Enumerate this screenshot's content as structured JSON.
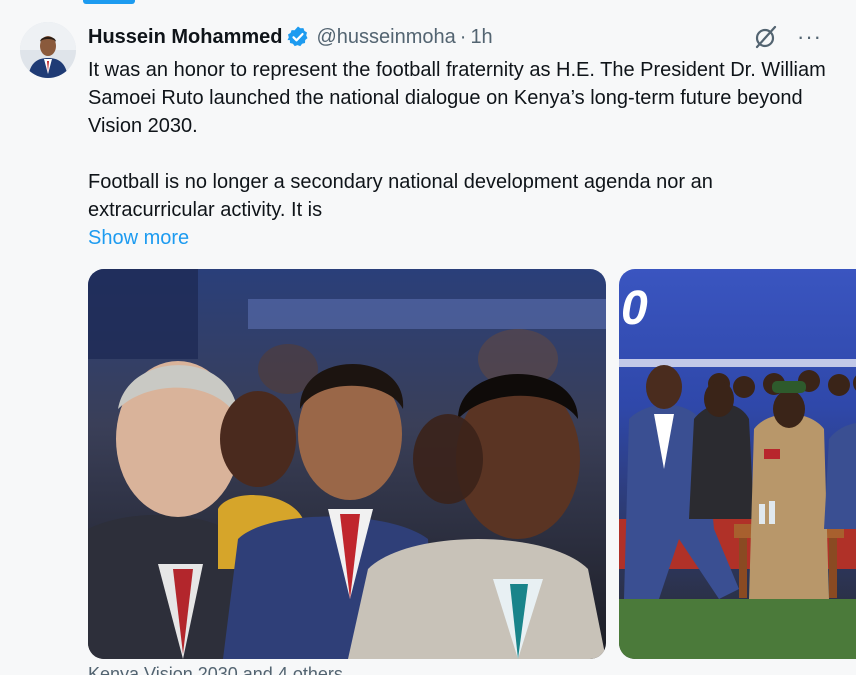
{
  "tweet": {
    "author_name": "Hussein Mohammed",
    "handle": "@husseinmoha",
    "separator": "·",
    "time": "1h",
    "more_label": "···",
    "text_p1": "It was an honor to represent the football fraternity as H.E. The President Dr. William Samoei Ruto launched the national dialogue on Kenya’s long-term future beyond Vision 2030.",
    "text_p2": "Football is no longer a secondary national development agenda nor an extracurricular activity. It is",
    "show_more": "Show more",
    "location_tag": "Kenya Vision 2030 and 4 others",
    "media": [
      {
        "icon": "photo-audience-icon"
      },
      {
        "icon": "photo-officials-seated-icon"
      }
    ]
  },
  "icons": {
    "verified": "verified-badge-icon",
    "grok": "grok-icon",
    "more": "more-icon"
  },
  "colors": {
    "accent": "#1d9bf0",
    "text": "#0f1419",
    "secondary": "#536471",
    "background": "#f7f8f9"
  }
}
